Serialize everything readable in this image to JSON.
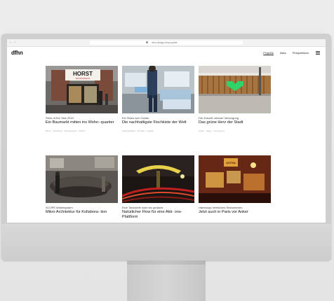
{
  "browser": {
    "url": "dfhn-design.de/projekte",
    "nav_back": "‹",
    "nav_forward": "›"
  },
  "site": {
    "logo": "dfhn",
    "nav": [
      {
        "label": "Projekte"
      },
      {
        "label": "Akku"
      },
      {
        "label": "Perspektiven"
      }
    ]
  },
  "projects": [
    {
      "category": "Store of the Year 2019",
      "title": "Ein Baumarkt mitten ins Wohn- quartier",
      "meta": "Baum · Handwerk · Wohnquartier · Zollhof"
    },
    {
      "category": "Ein Stück vom Ocean",
      "title": "Die nachhaltigste Fischkiste der Welt",
      "meta": "Nachhaltigkeit · Produkt · Logistik"
    },
    {
      "category": "Die Zukunft urbaner Versorgung",
      "title": "Das grüne Herz der Stadt",
      "meta": "Urban · Wege · Versorgung"
    },
    {
      "category": "SCOPE Möbelsystem",
      "title": "Mikro Architektur für Kollabora- tion",
      "meta": ""
    },
    {
      "category": "Eine Tankstelle wird neu gedacht",
      "title": "Natürlicher Flow für eine Akti- ons-Plattform",
      "meta": ""
    },
    {
      "category": "Hamburgs heimliches Stahlzeichen",
      "title": "Jetzt auch in Paris vor Anker",
      "meta": ""
    }
  ],
  "signage": {
    "horst": "HORST",
    "horst_sub": "BAUHOFFELD",
    "astra": "ASTRA"
  },
  "colors": {
    "accent_green": "#2fd36a",
    "screen_bg": "#ffffff",
    "frame": "#cfcfcf"
  }
}
